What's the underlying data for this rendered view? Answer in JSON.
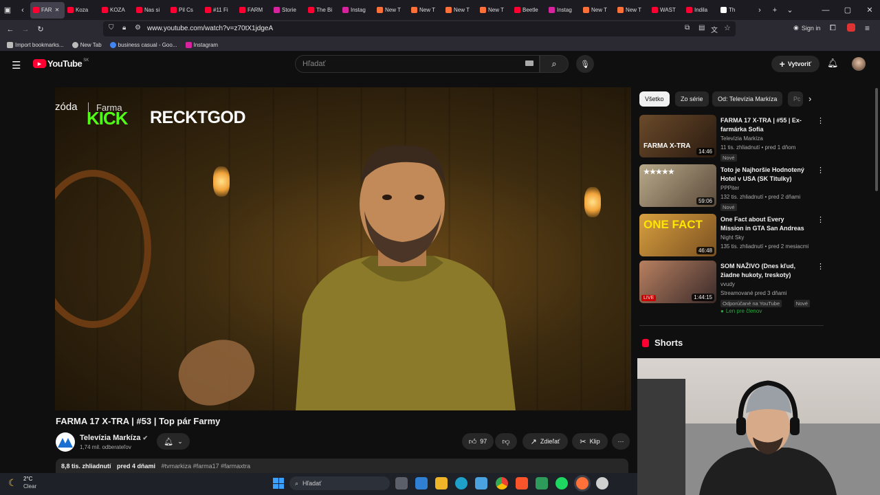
{
  "browser": {
    "tabs": [
      {
        "label": "FAR",
        "icon": "youtube-icon",
        "color": "#ff0033",
        "active": true
      },
      {
        "label": "Koza",
        "icon": "youtube-icon",
        "color": "#ff0033"
      },
      {
        "label": "KOZA",
        "icon": "youtube-icon",
        "color": "#ff0033"
      },
      {
        "label": "Nas si",
        "icon": "youtube-icon",
        "color": "#ff0033"
      },
      {
        "label": "Pil Cs",
        "icon": "youtube-icon",
        "color": "#ff0033"
      },
      {
        "label": "#11 Fi",
        "icon": "youtube-icon",
        "color": "#ff0033"
      },
      {
        "label": "FARM",
        "icon": "youtube-icon",
        "color": "#ff0033"
      },
      {
        "label": "Storie",
        "icon": "instagram-icon",
        "color": "#d6249f"
      },
      {
        "label": "The Bi",
        "icon": "youtube-icon",
        "color": "#ff0033"
      },
      {
        "label": "Instag",
        "icon": "instagram-icon",
        "color": "#d6249f"
      },
      {
        "label": "New T",
        "icon": "firefox-icon",
        "color": "#ff7139"
      },
      {
        "label": "New T",
        "icon": "firefox-icon",
        "color": "#ff7139"
      },
      {
        "label": "New T",
        "icon": "firefox-icon",
        "color": "#ff7139"
      },
      {
        "label": "New T",
        "icon": "firefox-icon",
        "color": "#ff7139"
      },
      {
        "label": "Beetle",
        "icon": "youtube-icon",
        "color": "#ff0033"
      },
      {
        "label": "Instag",
        "icon": "instagram-icon",
        "color": "#d6249f"
      },
      {
        "label": "New T",
        "icon": "firefox-icon",
        "color": "#ff7139"
      },
      {
        "label": "New T",
        "icon": "firefox-icon",
        "color": "#ff7139"
      },
      {
        "label": "WAST",
        "icon": "youtube-icon",
        "color": "#ff0033"
      },
      {
        "label": "Indila",
        "icon": "youtube-icon",
        "color": "#ff0033"
      },
      {
        "label": "Th",
        "icon": "diamond-icon",
        "color": "#ffffff"
      }
    ],
    "url": "www.youtube.com/watch?v=z70tX1jdgeA",
    "sign_in": "Sign in",
    "bookmarks": [
      {
        "label": "Import bookmarks...",
        "icon": "import-icon"
      },
      {
        "label": "New Tab",
        "icon": "globe-icon"
      },
      {
        "label": "business casual - Goo...",
        "icon": "google-icon"
      },
      {
        "label": "Instagram",
        "icon": "instagram-icon"
      }
    ]
  },
  "youtube": {
    "logo": "YouTube",
    "region": "SK",
    "search_placeholder": "Hľadať",
    "create_label": "Vytvoriť"
  },
  "video": {
    "overlay_left": "zóda",
    "overlay_farma": "Farma",
    "kick_label": "KICK",
    "streamer": "RECKTGOD",
    "title": "FARMA 17 X-TRA | #53 | Top pár Farmy",
    "channel": "Televízia Markíza",
    "subscribers": "1,74 mil. odberateľov",
    "likes": "97",
    "share_label": "Zdieľať",
    "clip_label": "Klip",
    "views": "8,8 tis. zhliadnutí",
    "date": "pred 4 dňami",
    "tags": "#tvmarkiza #farma17 #farmaxtra"
  },
  "sidebar": {
    "chips": [
      "Všetko",
      "Zo série",
      "Od: Televízia Markíza",
      "Pc"
    ],
    "recs": [
      {
        "title": "FARMA 17 X-TRA | #55 | Ex-farmárka Sofia",
        "channel": "Televízia Markíza",
        "meta": "11 tis. zhliadnutí • pred 1 dňom",
        "badges": [
          "Nové"
        ],
        "duration": "14:46",
        "thumb_text": "FARMA X-TRA"
      },
      {
        "title": "Toto je Najhoršie Hodnotený Hotel v USA (SK Titulky)",
        "channel": "PPPiter",
        "meta": "132 tis. zhliadnutí • pred 2 dňami",
        "badges": [
          "Nové"
        ],
        "duration": "59:06",
        "thumb_text": "★★★★★"
      },
      {
        "title": "One Fact about Every Mission in GTA San Andreas",
        "channel": "Night Sky",
        "meta": "135 tis. zhliadnutí • pred 2 mesiacmi",
        "badges": [],
        "duration": "46:48",
        "thumb_text": "ONE FACT"
      },
      {
        "title": "SOM NAŽIVO (Dnes kľud, žiadne hukoty, treskoty)",
        "channel": "vvudy",
        "meta": "Streamované pred 3 dňami",
        "badges": [
          "Odporúčané na YouTube",
          "Nové"
        ],
        "members": "Len pre členov",
        "duration": "1:44:15",
        "live_badge": "LIVE"
      }
    ],
    "shorts_label": "Shorts"
  },
  "taskbar": {
    "weather_temp": "2°C",
    "weather_desc": "Clear",
    "search_placeholder": "Hľadať"
  }
}
